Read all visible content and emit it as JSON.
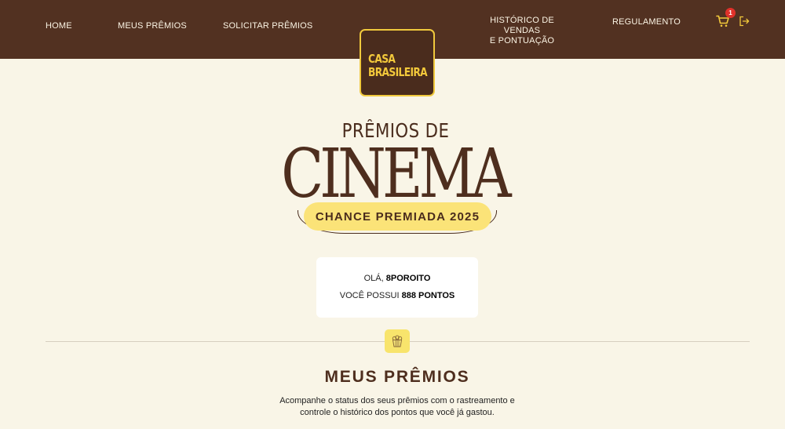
{
  "nav": {
    "home": "HOME",
    "meus_premios": "MEUS PRÊMIOS",
    "solicitar_premios": "SOLICITAR PRÊMIOS",
    "historico_line1": "HISTÓRICO DE VENDAS",
    "historico_line2": "E PONTUAÇÃO",
    "regulamento": "REGULAMENTO",
    "cart_count": "1"
  },
  "logo": {
    "line1": "CASA",
    "line2": "BRASILEIRA"
  },
  "hero": {
    "premios_de": "PRÊMIOS DE",
    "cinema": "CINEMA",
    "chance": "CHANCE PREMIADA 2025"
  },
  "user_card": {
    "greeting_prefix": "OLÁ, ",
    "username": "8POROITO",
    "points_prefix": "VOCÊ POSSUI ",
    "points_value": "888 PONTOS"
  },
  "section": {
    "title": "MEUS PRÊMIOS",
    "description": "Acompanhe o status dos seus prêmios com o rastreamento e controle o histórico dos pontos que você já gastou."
  },
  "icons": {
    "cart": "cart-icon",
    "logout": "logout-icon",
    "popcorn": "popcorn-icon"
  },
  "colors": {
    "header_bg": "#523121",
    "page_bg": "#f9f5e7",
    "accent_yellow": "#f3c93b",
    "badge_red": "#e0312a"
  }
}
